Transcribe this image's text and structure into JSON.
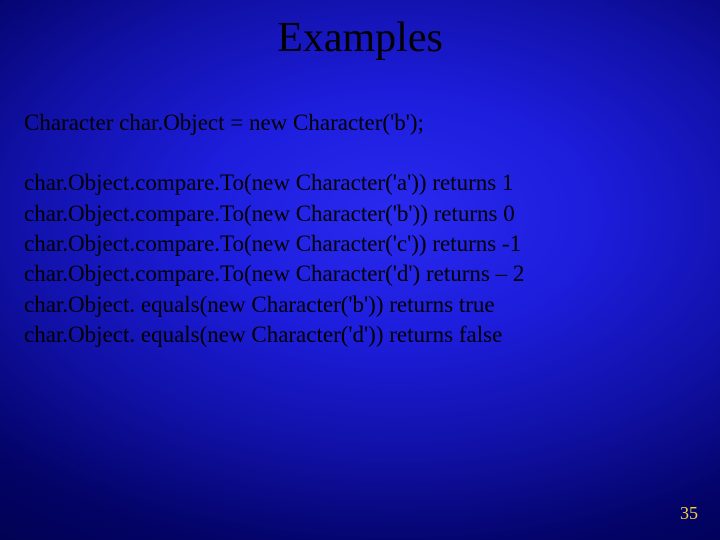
{
  "title": "Examples",
  "declaration": "Character char.Object = new Character('b');",
  "lines": [
    "char.Object.compare.To(new Character('a')) returns 1",
    "char.Object.compare.To(new Character('b')) returns 0",
    "char.Object.compare.To(new Character('c')) returns -1",
    "char.Object.compare.To(new Character('d') returns – 2",
    "char.Object. equals(new Character('b')) returns true",
    "char.Object. equals(new Character('d')) returns false"
  ],
  "page_number": "35"
}
